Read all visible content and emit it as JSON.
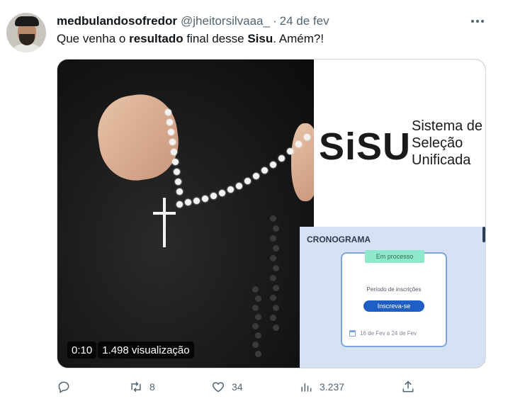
{
  "tweet": {
    "author_name": "medbulandosofredor",
    "handle": "@jheitorsilvaaa_",
    "separator": "·",
    "date": "24 de fev",
    "text_parts": {
      "p1": "Que venha o ",
      "b1": "resultado",
      "p2": " final desse ",
      "b2": "Sisu",
      "p3": ". Amém?!"
    }
  },
  "media": {
    "logo": "SiSU",
    "subtitle_line1": "Sistema de",
    "subtitle_line2": "Seleção",
    "subtitle_line3": "Unificada",
    "cronograma_title": "CRONOGRAMA",
    "badge": "Em processo",
    "periodo": "Período de inscrições",
    "button": "Inscreva-se",
    "dates": "16 de Fev a 24 de Fev",
    "video_time": "0:10",
    "views": "1.498 visualização"
  },
  "actions": {
    "reply_icon": "reply-icon",
    "retweet_count": "8",
    "like_count": "34",
    "views_count": "3.237",
    "share_icon": "share-icon"
  },
  "colors": {
    "text": "#0f1419",
    "muted": "#536471",
    "cronograma_bg": "#d6e2f3",
    "button_blue": "#1f5fc4",
    "badge_green": "#8ee8cc"
  }
}
